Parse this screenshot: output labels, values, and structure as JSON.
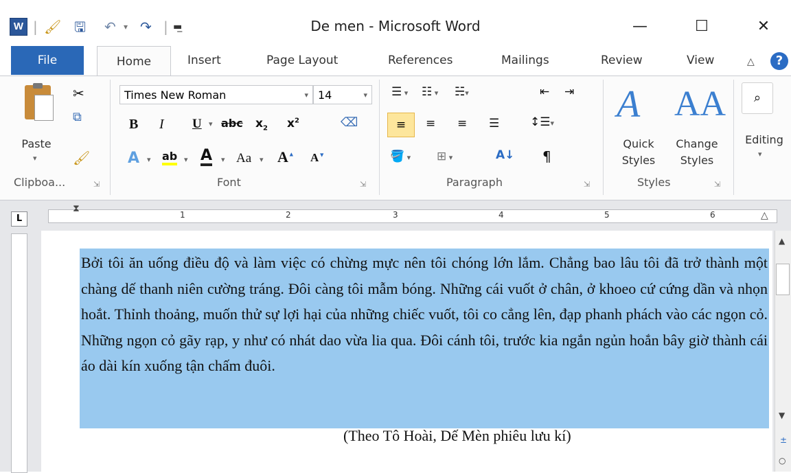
{
  "window": {
    "title": "De men  -  Microsoft Word",
    "quick_access": [
      "word-logo-icon",
      "format-painter-icon",
      "save-icon",
      "undo-icon",
      "redo-icon",
      "customize-icon"
    ]
  },
  "tabs": [
    "File",
    "Home",
    "Insert",
    "Page Layout",
    "References",
    "Mailings",
    "Review",
    "View"
  ],
  "ribbon": {
    "clipboard": {
      "paste_label": "Paste",
      "group_label": "Clipboa..."
    },
    "font": {
      "font_name": "Times New Roman",
      "font_size": "14",
      "aa_label": "Aa",
      "group_label": "Font"
    },
    "paragraph": {
      "group_label": "Paragraph"
    },
    "styles": {
      "quick_styles": "Quick\nStyles",
      "change_styles": "Change\nStyles",
      "group_label": "Styles"
    },
    "editing": {
      "label": "Editing"
    }
  },
  "ruler": {
    "numbers": [
      "1",
      "2",
      "3",
      "4",
      "5",
      "6"
    ],
    "tab_selector": "L"
  },
  "document": {
    "paragraph": "Bởi tôi ăn uống điều độ và làm việc có chừng mực nên tôi chóng lớn lắm. Chẳng bao lâu tôi đã trở thành một chàng dế thanh niên cường tráng. Đôi càng tôi mẫm bóng. Những cái vuốt ở chân, ở khoeo cứ cứng dần và nhọn hoắt. Thỉnh thoảng, muốn thử sự lợi hại của những chiếc vuốt, tôi co cẳng lên, đạp phanh phách vào các ngọn cỏ. Những ngọn cỏ gãy rạp, y như có nhát dao vừa lia qua. Đôi cánh tôi, trước kia ngắn ngủn hoắn bây giờ thành cái áo dài kín xuống tận chấm đuôi.",
    "citation": "(Theo Tô Hoài, Dế Mèn phiêu lưu kí)",
    "selection_color": "#99c9ef"
  }
}
